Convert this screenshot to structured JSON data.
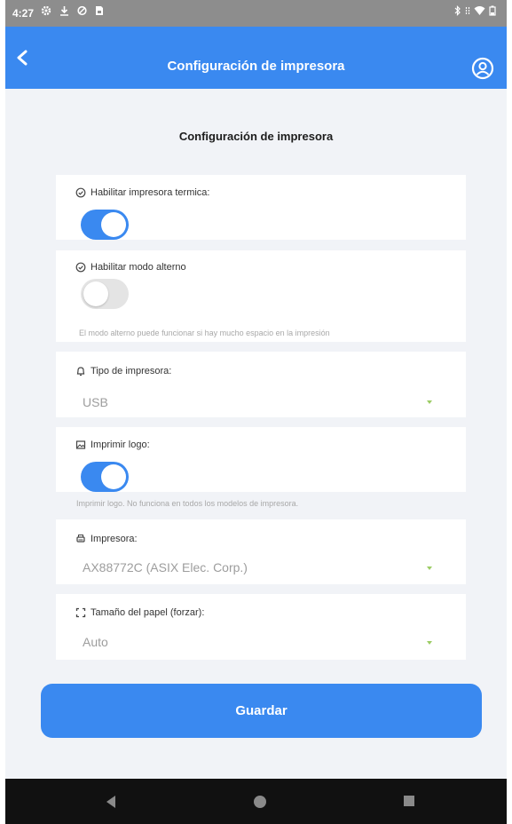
{
  "status_bar": {
    "time": "4:27",
    "left_icons": [
      "settings-icon",
      "download-icon",
      "shield-icon",
      "sim-icon"
    ],
    "right_icons": [
      "bluetooth-icon",
      "data-icon",
      "wifi-icon",
      "battery-icon"
    ]
  },
  "header": {
    "title": "Configuración de impresora",
    "color": "#3a89f0"
  },
  "section_title": "Configuración de impresora",
  "settings": {
    "thermal": {
      "label": "Habilitar impresora termica:",
      "enabled": true
    },
    "alt_mode": {
      "label": "Habilitar modo alterno",
      "enabled": false,
      "helper": "El modo alterno puede funcionar si hay mucho espacio en la impresión"
    },
    "printer_type": {
      "label": "Tipo de impresora:",
      "value": "USB"
    },
    "print_logo": {
      "label": "Imprimir logo:",
      "enabled": true,
      "helper": "Imprimir logo. No funciona en todos los modelos de impresora."
    },
    "printer": {
      "label": "Impresora:",
      "value": "AX88772C (ASIX Elec. Corp.)"
    },
    "paper_size": {
      "label": "Tamaño del papel (forzar):",
      "value": "Auto"
    }
  },
  "save_button": "Guardar",
  "nav": [
    "back-icon",
    "home-icon",
    "recents-icon"
  ]
}
